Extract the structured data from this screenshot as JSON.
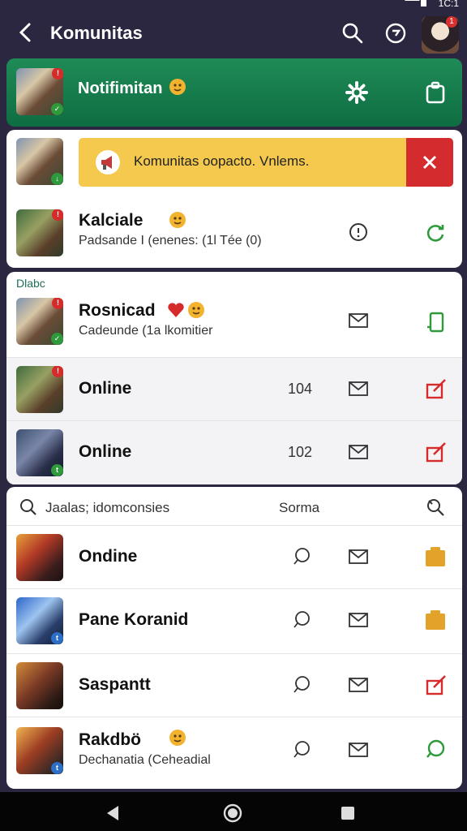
{
  "status_bar": {
    "time": "1C:1",
    "signal_icon": "signal-icon",
    "battery_icon": "battery-icon"
  },
  "header": {
    "title": "Komunitas",
    "back_icon": "back-arrow-icon",
    "search_icon": "search-icon",
    "chat_icon": "chat-icon",
    "avatar_badge": "1"
  },
  "notification_card": {
    "title": "Notifimitan",
    "settings_icon": "gear-icon",
    "share_icon": "clipboard-icon"
  },
  "alert_card": {
    "banner_text": "Komunitas oopacto. Vnlems.",
    "banner_icon": "megaphone-icon",
    "close_icon": "close-icon",
    "row": {
      "name": "Kalciale",
      "sub": "Padsande I (enenes: (1l Tée (0)"
    }
  },
  "online_card": {
    "section_label": "Dlabc",
    "rows": [
      {
        "name": "Rosnicad",
        "sub": "Cadeunde (1a lkomitier",
        "count": ""
      },
      {
        "name": "Online",
        "sub": "",
        "count": "104"
      },
      {
        "name": "Online",
        "sub": "",
        "count": "102"
      }
    ]
  },
  "community_card": {
    "search_placeholder": "Jaalas; idomconsies",
    "filter_label": "Sorma",
    "rows": [
      {
        "name": "Ondine",
        "sub": ""
      },
      {
        "name": "Pane Koranid",
        "sub": ""
      },
      {
        "name": "Saspantt",
        "sub": ""
      },
      {
        "name": "Rakdbö",
        "sub": "Dechanatia (Ceheadial"
      }
    ]
  },
  "nav_bar": {
    "back": "nav-back-icon",
    "home": "nav-home-icon",
    "recents": "nav-recents-icon"
  },
  "colors": {
    "header_bg": "#2b2740",
    "notif_green": "#0e6d42",
    "banner_yellow": "#f4c94e",
    "alert_red": "#d42b2f",
    "icon_green": "#2e9a3b",
    "icon_red": "#d62b2b",
    "icon_orange": "#e3a22a"
  }
}
